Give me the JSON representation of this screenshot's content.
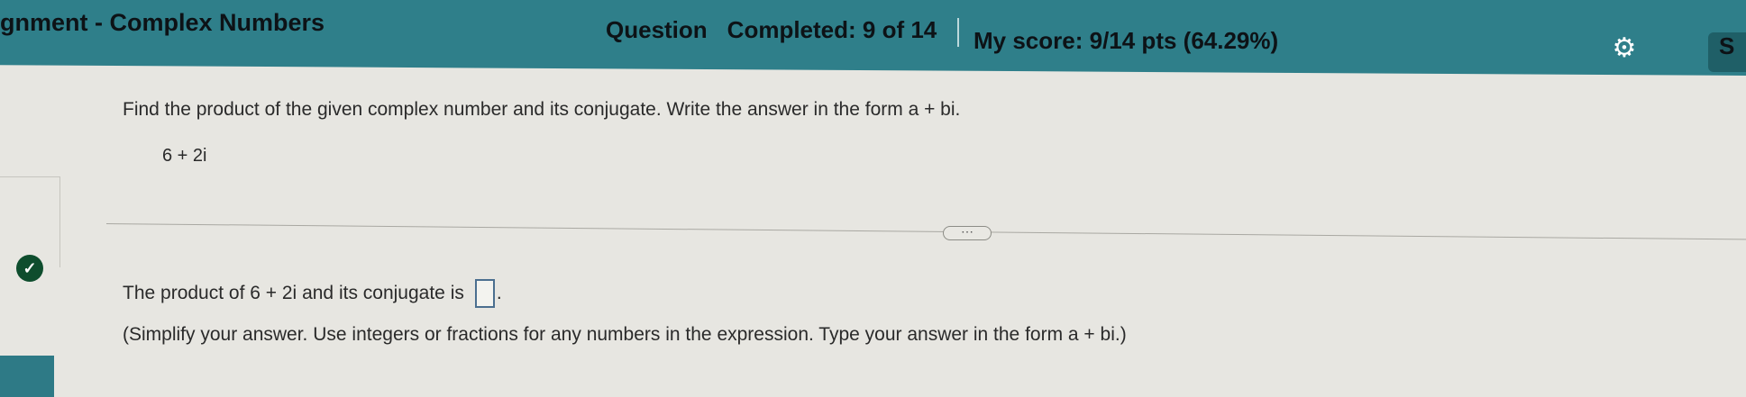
{
  "header": {
    "title": "gnment - Complex Numbers",
    "question_label": "Question",
    "completed_text": "Completed: 9 of 14",
    "score_text": "My score: 9/14 pts (64.29%)",
    "settings_icon": "gear-icon",
    "more_label": "S"
  },
  "question": {
    "instruction": "Find the product of the given complex number and its conjugate. Write the answer in the form a + bi.",
    "given": "6 + 2i",
    "more_button": "⋯"
  },
  "answer": {
    "status_icon": "check-icon",
    "product_prefix": "The product of",
    "product_expr": "6 + 2i",
    "product_suffix": "and its conjugate is",
    "period": ".",
    "value": "",
    "hint": "(Simplify your answer. Use integers or fractions for any numbers in the expression. Type your answer in the form a + bi.)"
  },
  "colors": {
    "header_bg": "#2f7f8a",
    "page_bg": "#e7e6e1",
    "check_bg": "#0e4d2d"
  }
}
